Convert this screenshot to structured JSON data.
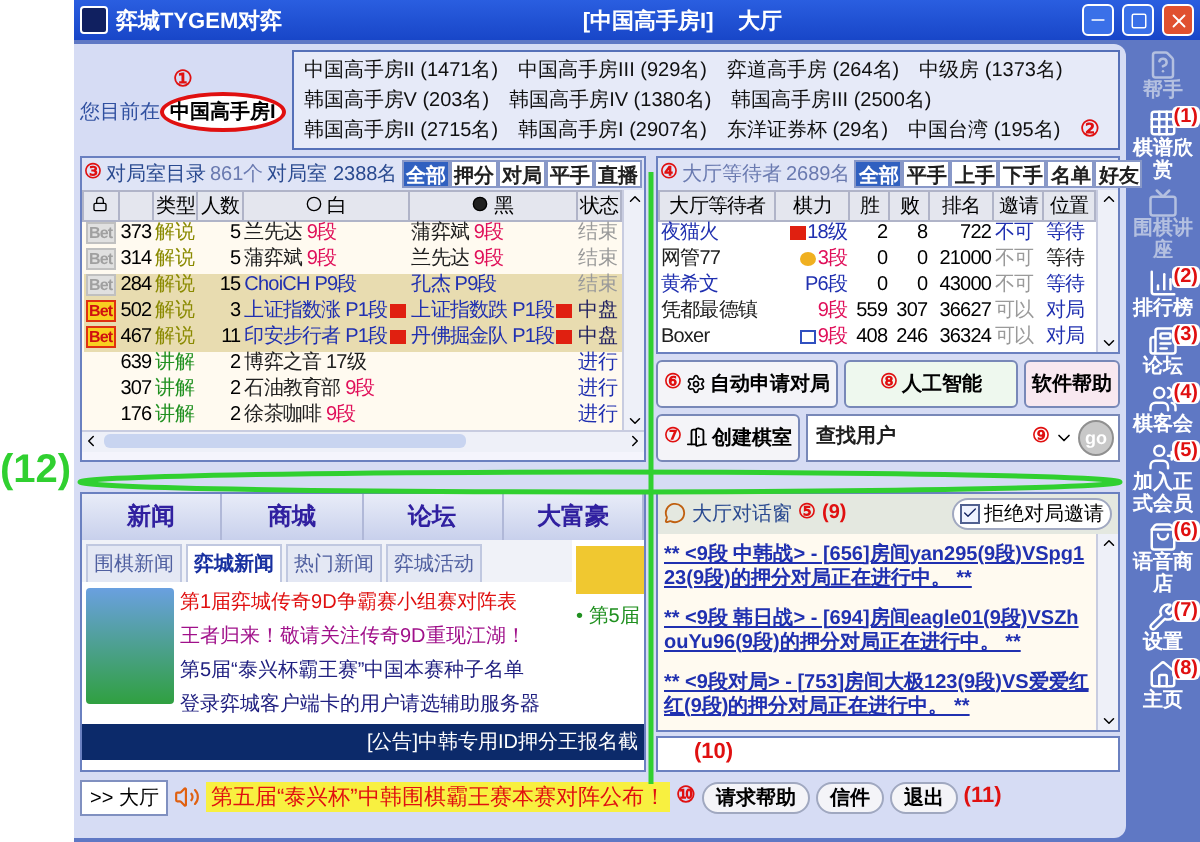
{
  "window": {
    "app_title": "弈城TYGEM对弈",
    "room_title": "[中国高手房I]",
    "hall_title": "大厅"
  },
  "location": {
    "label": "您目前在",
    "current": "中国高手房I",
    "marker": "①"
  },
  "rooms": {
    "marker": "②",
    "items": [
      "中国高手房II (1471名)",
      "中国高手房III (929名)",
      "弈道高手房 (264名)",
      "中级房 (1373名)",
      "韩国高手房V (203名)",
      "韩国高手房IV (1380名)",
      "韩国高手房III (2500名)",
      "韩国高手房II (2715名)",
      "韩国高手房I (2907名)",
      "东洋证券杯 (29名)",
      "中国台湾 (195名)"
    ]
  },
  "game_list": {
    "marker": "③",
    "title": "对局室目录",
    "count": "861个",
    "players": "对局室 2388名",
    "filters": [
      {
        "label": "全部",
        "selected": true
      },
      {
        "label": "押分",
        "selected": false
      },
      {
        "label": "对局",
        "selected": false
      },
      {
        "label": "平手",
        "selected": false
      },
      {
        "label": "直播",
        "selected": false
      }
    ],
    "columns": [
      "类型",
      "人数",
      "白",
      "黑",
      "状态"
    ],
    "rows": [
      {
        "bet": {
          "label": "Bet",
          "active": false
        },
        "id": "373",
        "type": {
          "text": "解说",
          "color": "#8a8a00"
        },
        "people": "5",
        "white": {
          "name": {
            "text": "兰先达",
            "color": "#202020"
          },
          "rank": {
            "text": "9段",
            "color": "#e0105a"
          },
          "flag": false
        },
        "black": {
          "name": {
            "text": "蒲弈斌",
            "color": "#202020"
          },
          "rank": {
            "text": "9段",
            "color": "#e0105a"
          },
          "flag": false
        },
        "status": {
          "text": "结束",
          "color": "#9a9a9a"
        },
        "highlighted": false
      },
      {
        "bet": {
          "label": "Bet",
          "active": false
        },
        "id": "314",
        "type": {
          "text": "解说",
          "color": "#8a8a00"
        },
        "people": "5",
        "white": {
          "name": {
            "text": "蒲弈斌",
            "color": "#202020"
          },
          "rank": {
            "text": "9段",
            "color": "#e0105a"
          },
          "flag": false
        },
        "black": {
          "name": {
            "text": "兰先达",
            "color": "#202020"
          },
          "rank": {
            "text": "9段",
            "color": "#e0105a"
          },
          "flag": false
        },
        "status": {
          "text": "结束",
          "color": "#9a9a9a"
        },
        "highlighted": false
      },
      {
        "bet": {
          "label": "Bet",
          "active": false
        },
        "id": "284",
        "type": {
          "text": "解说",
          "color": "#8a8a00"
        },
        "people": "15",
        "white": {
          "name": {
            "text": "ChoiCH",
            "color": "#2030b0"
          },
          "rank": {
            "text": "P9段",
            "color": "#2030b0"
          },
          "flag": false
        },
        "black": {
          "name": {
            "text": "孔杰",
            "color": "#2030b0"
          },
          "rank": {
            "text": "P9段",
            "color": "#2030b0"
          },
          "flag": false
        },
        "status": {
          "text": "结束",
          "color": "#9a9a9a"
        },
        "highlighted": true
      },
      {
        "bet": {
          "label": "Bet",
          "active": true
        },
        "id": "502",
        "type": {
          "text": "解说",
          "color": "#8a8a00"
        },
        "people": "3",
        "white": {
          "name": {
            "text": "上证指数涨",
            "color": "#2030b0"
          },
          "rank": {
            "text": "P1段",
            "color": "#2030b0"
          },
          "flag": true
        },
        "black": {
          "name": {
            "text": "上证指数跌",
            "color": "#2030b0"
          },
          "rank": {
            "text": "P1段",
            "color": "#2030b0"
          },
          "flag": true
        },
        "status": {
          "text": "中盘",
          "color": "#202060"
        },
        "highlighted": true
      },
      {
        "bet": {
          "label": "Bet",
          "active": true
        },
        "id": "467",
        "type": {
          "text": "解说",
          "color": "#8a8a00"
        },
        "people": "11",
        "white": {
          "name": {
            "text": "印安步行者",
            "color": "#2030b0"
          },
          "rank": {
            "text": "P1段",
            "color": "#2030b0"
          },
          "flag": true
        },
        "black": {
          "name": {
            "text": "丹佛掘金队",
            "color": "#2030b0"
          },
          "rank": {
            "text": "P1段",
            "color": "#2030b0"
          },
          "flag": true
        },
        "status": {
          "text": "中盘",
          "color": "#202060"
        },
        "highlighted": true
      },
      {
        "id": "639",
        "type": {
          "text": "讲解",
          "color": "#209020"
        },
        "people": "2",
        "white": {
          "name": {
            "text": "博弈之音",
            "color": "#202020"
          },
          "rank": {
            "text": "17级",
            "color": "#202020"
          },
          "flag": false
        },
        "status": {
          "text": "进行",
          "color": "#2030b0"
        },
        "highlighted": false
      },
      {
        "id": "307",
        "type": {
          "text": "讲解",
          "color": "#209020"
        },
        "people": "2",
        "white": {
          "name": {
            "text": "石油教育部",
            "color": "#202020"
          },
          "rank": {
            "text": "9段",
            "color": "#e0105a"
          },
          "flag": false
        },
        "status": {
          "text": "进行",
          "color": "#2030b0"
        },
        "highlighted": false
      },
      {
        "id": "176",
        "type": {
          "text": "讲解",
          "color": "#209020"
        },
        "people": "2",
        "white": {
          "name": {
            "text": "徐茶咖啡",
            "color": "#202020"
          },
          "rank": {
            "text": "9段",
            "color": "#e0105a"
          },
          "flag": false
        },
        "status": {
          "text": "进行",
          "color": "#2030b0"
        },
        "highlighted": false
      }
    ]
  },
  "waiting_list": {
    "marker": "④",
    "title": "大厅等待者",
    "count": "2689名",
    "filters": [
      {
        "label": "全部",
        "selected": true
      },
      {
        "label": "平手",
        "selected": false
      },
      {
        "label": "上手",
        "selected": false
      },
      {
        "label": "下手",
        "selected": false
      },
      {
        "label": "名单",
        "selected": false
      },
      {
        "label": "好友",
        "selected": false
      }
    ],
    "columns": [
      "大厅等待者",
      "棋力",
      "胜",
      "败",
      "排名",
      "邀请",
      "位置"
    ],
    "rows": [
      {
        "name": {
          "text": "夜猫火",
          "color": "#2030b0"
        },
        "kind": "cn",
        "rank": {
          "text": "18级",
          "color": "#2030b0"
        },
        "wins": "2",
        "losses": "8",
        "ranking": "722",
        "invite": {
          "text": "不可",
          "color": "#2030b0"
        },
        "location": {
          "text": "等待",
          "color": "#2030b0"
        }
      },
      {
        "name": {
          "text": "网管77",
          "color": "#202020"
        },
        "kind": "avatar",
        "rank": {
          "text": "3段",
          "color": "#e0105a"
        },
        "wins": "0",
        "losses": "0",
        "ranking": "21000",
        "invite": {
          "text": "不可",
          "color": "#9a9a9a"
        },
        "location": {
          "text": "等待",
          "color": "#202020"
        }
      },
      {
        "name": {
          "text": "黄希文",
          "color": "#2030b0"
        },
        "kind": "plain",
        "rank": {
          "text": "P6段",
          "color": "#2030b0"
        },
        "wins": "0",
        "losses": "0",
        "ranking": "43000",
        "invite": {
          "text": "不可",
          "color": "#9a9a9a"
        },
        "location": {
          "text": "等待",
          "color": "#2030b0"
        }
      },
      {
        "name": {
          "text": "凭都最德镇",
          "color": "#202020"
        },
        "kind": "plain",
        "rank": {
          "text": "9段",
          "color": "#e0105a"
        },
        "wins": "559",
        "losses": "307",
        "ranking": "36627",
        "invite": {
          "text": "可以",
          "color": "#9a9a9a"
        },
        "location": {
          "text": "对局",
          "color": "#2030b0"
        }
      },
      {
        "name": {
          "text": "Boxer",
          "color": "#202020"
        },
        "kind": "kr",
        "rank": {
          "text": "9段",
          "color": "#e0105a"
        },
        "wins": "408",
        "losses": "246",
        "ranking": "36324",
        "invite": {
          "text": "可以",
          "color": "#9a9a9a"
        },
        "location": {
          "text": "对局",
          "color": "#2030b0"
        }
      }
    ]
  },
  "actions": {
    "auto_match": {
      "label": "自动申请对局",
      "marker": "⑥"
    },
    "ai": {
      "label": "人工智能",
      "marker": "⑧"
    },
    "help": {
      "label": "软件帮助"
    },
    "create_room": {
      "label": "创建棋室",
      "marker": "⑦"
    },
    "find_user": {
      "placeholder": "查找用户",
      "marker": "⑨",
      "go": "go"
    }
  },
  "news": {
    "sections": [
      "新闻",
      "商城",
      "论坛",
      "大富豪"
    ],
    "tabs": [
      {
        "label": "围棋新闻",
        "selected": false
      },
      {
        "label": "弈城新闻",
        "selected": true
      },
      {
        "label": "热门新闻",
        "selected": false
      },
      {
        "label": "弈城活动",
        "selected": false
      }
    ],
    "headlines": [
      {
        "text": "第1届弈城传奇9D争霸赛小组赛对阵表",
        "color": "#e01010"
      },
      {
        "text": "王者归来！敬请关注传奇9D重现江湖！",
        "color": "#a0108a"
      },
      {
        "text": "第5届“泰兴杯霸王赛”中国本赛种子名单",
        "color": "#202080"
      },
      {
        "text": "登录弈城客户端卡的用户请选辅助服务器",
        "color": "#202080"
      }
    ],
    "side_text": "• 第5届",
    "announcement": "[公告]中韩专用ID押分王报名截"
  },
  "chat": {
    "title": "大厅对话窗",
    "marker": "⑤",
    "reject": {
      "label": "拒绝对局邀请",
      "checked": true,
      "marker": "(9)"
    },
    "messages": [
      "** <9段 中韩战> - [656]房间yan295(9段)VSpg123(9段)的押分对局正在进行中。 **",
      "** <9段 韩日战> - [694]房间eagle01(9段)VSZhouYu96(9段)的押分对局正在进行中。 **",
      "** <9段对局> - [753]房间大极123(9段)VS爱爱红红(9段)的押分对局正在进行中。 **"
    ],
    "input_marker": "(10)"
  },
  "bottom_bar": {
    "tab": ">> 大厅",
    "ticker": "第五届“泰兴杯”中韩围棋霸王赛本赛对阵公布！",
    "marker": "⑩",
    "buttons": [
      "请求帮助",
      "信件",
      "退出"
    ],
    "end_marker": "(11)"
  },
  "sidebar": [
    {
      "label": "帮手",
      "disabled": true
    },
    {
      "label": "棋谱欣赏",
      "disabled": false,
      "marker": "(1)"
    },
    {
      "label": "围棋讲座",
      "disabled": true
    },
    {
      "label": "排行榜",
      "disabled": false,
      "marker": "(2)"
    },
    {
      "label": "论坛",
      "disabled": false,
      "marker": "(3)"
    },
    {
      "label": "棋客会",
      "disabled": false,
      "marker": "(4)"
    },
    {
      "label": "加入正式会员",
      "disabled": false,
      "marker": "(5)"
    },
    {
      "label": "语音商店",
      "disabled": false,
      "marker": "(6)"
    },
    {
      "label": "设置",
      "disabled": false,
      "marker": "(7)"
    },
    {
      "label": "主页",
      "disabled": false,
      "marker": "(8)"
    }
  ],
  "annotation": {
    "label": "(12)"
  }
}
